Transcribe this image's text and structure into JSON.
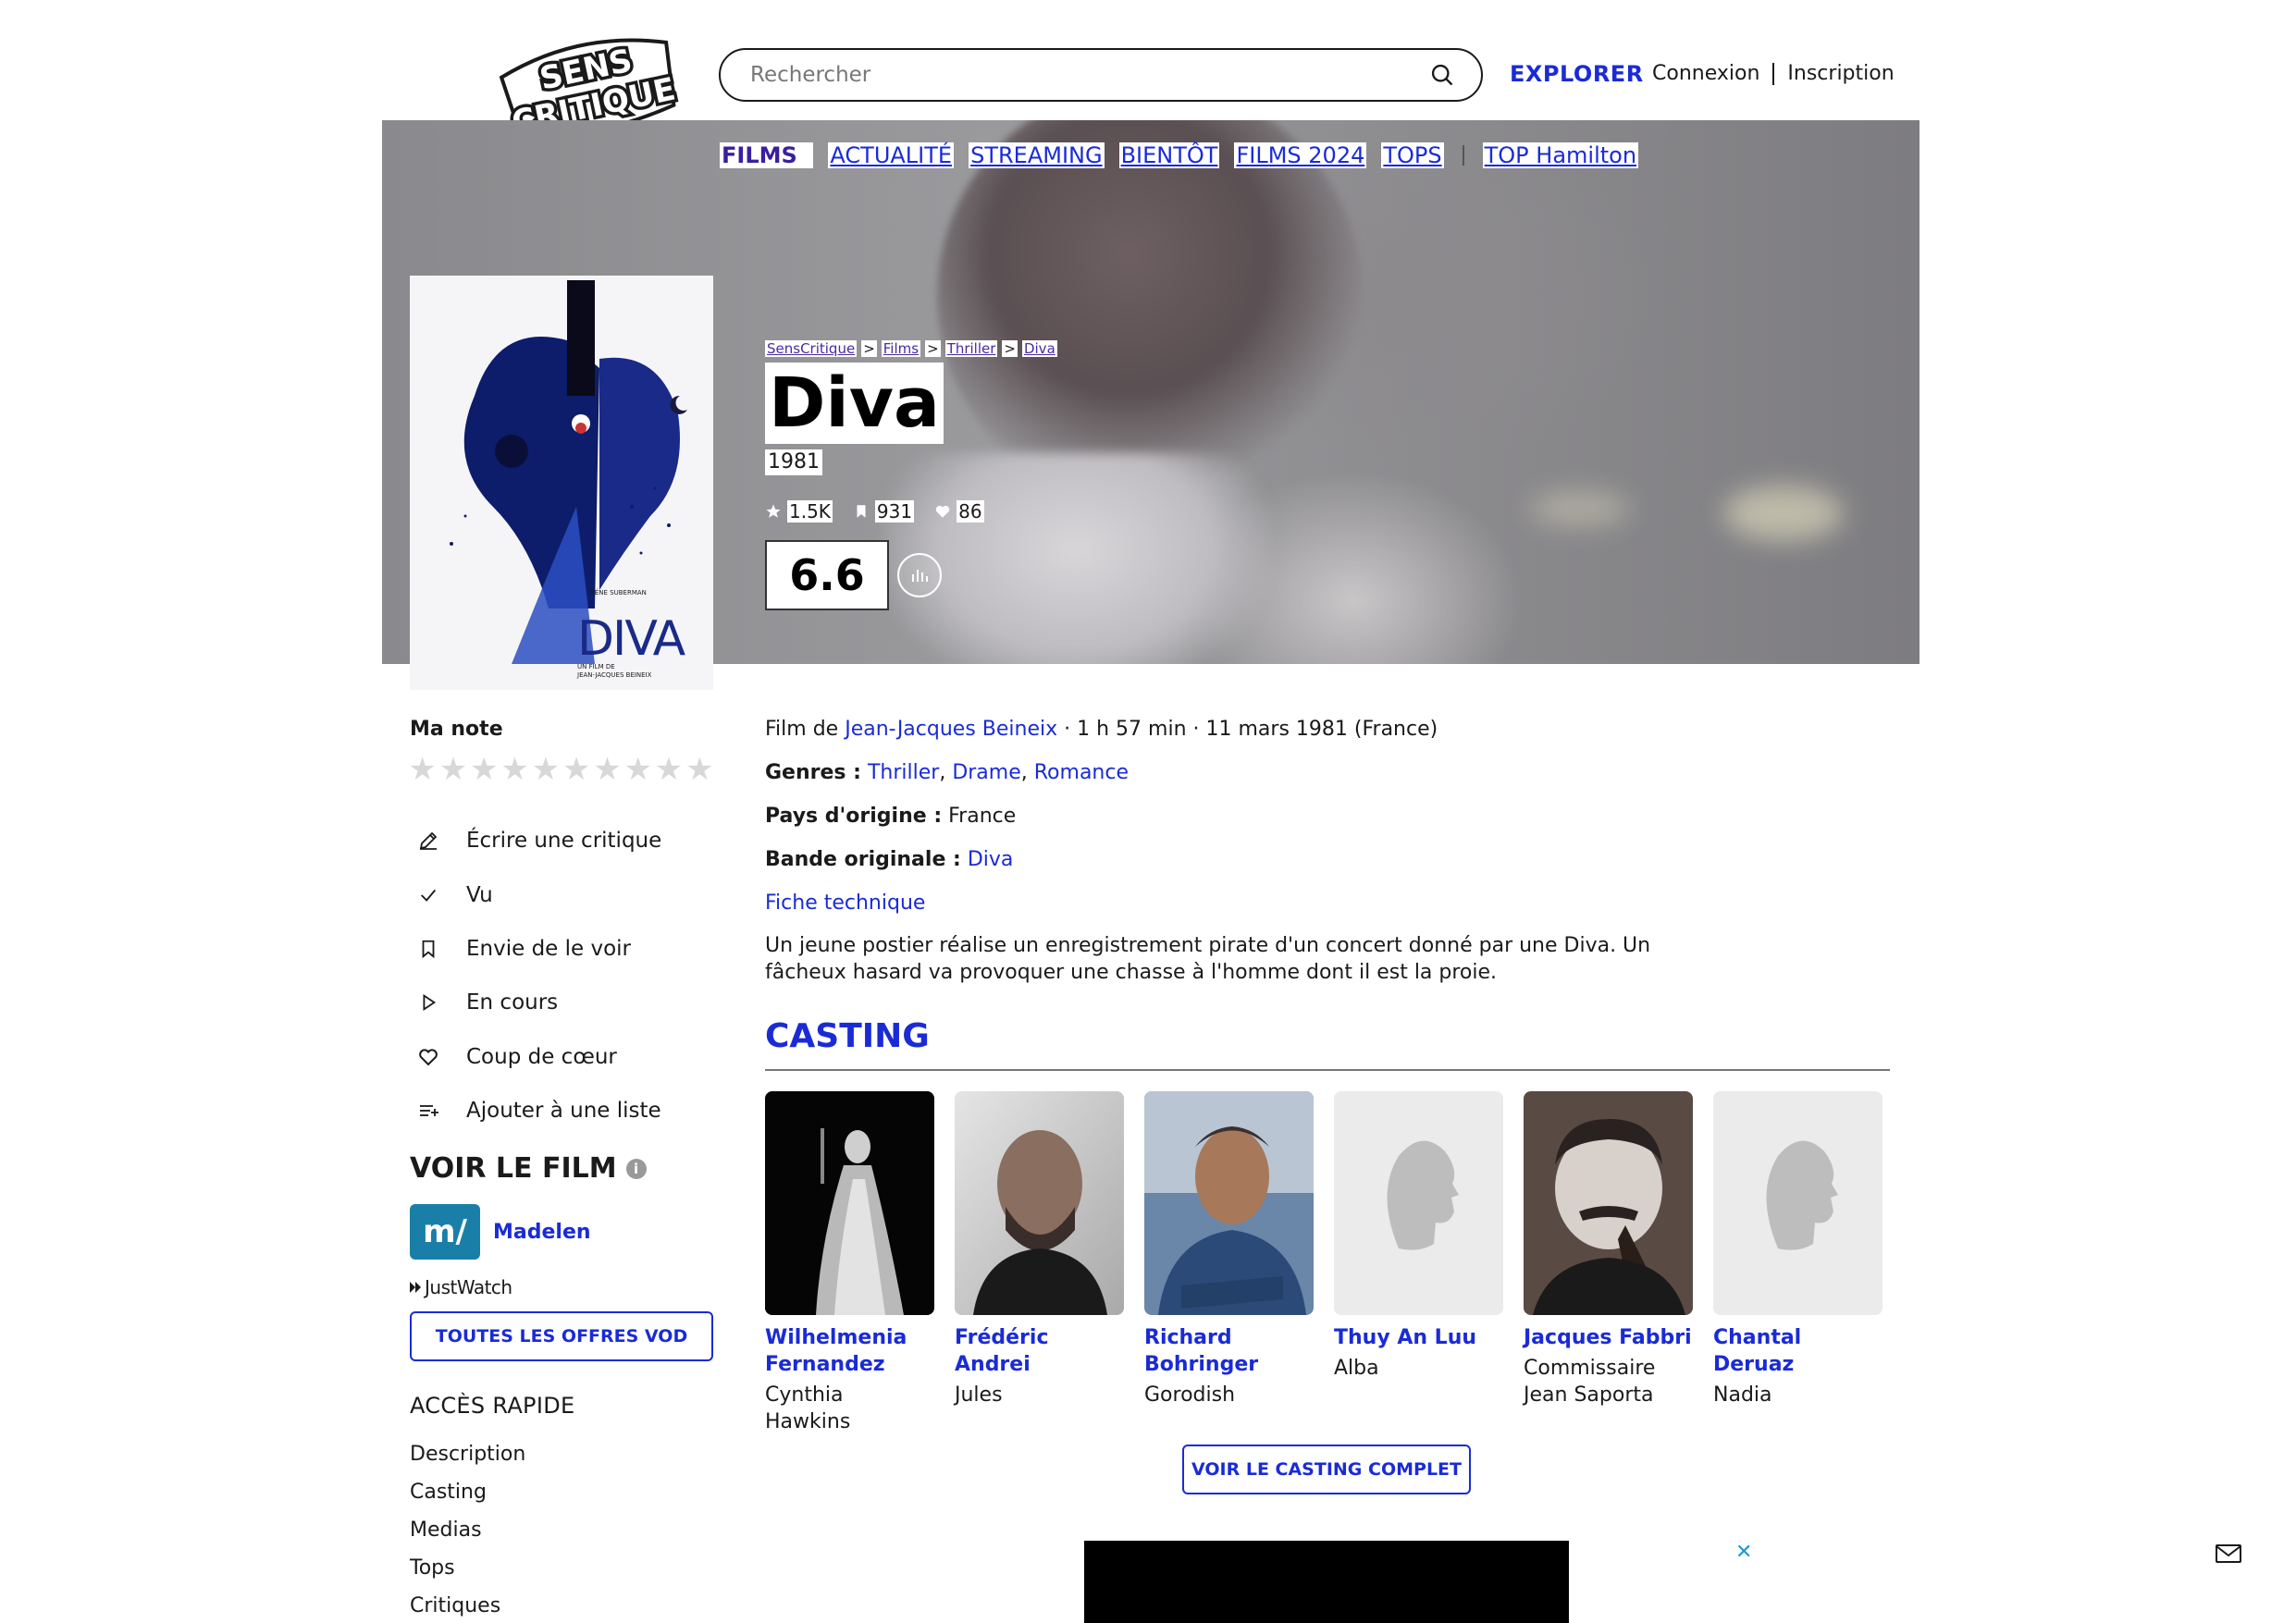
{
  "header": {
    "logo_text": [
      "SENS",
      "CRITIQUE"
    ],
    "search_placeholder": "Rechercher",
    "explorer_label": "EXPLORER",
    "login_label": "Connexion",
    "signup_label": "Inscription"
  },
  "subnav": {
    "films": "FILMS",
    "items": [
      "ACTUALITÉ",
      "STREAMING",
      "BIENTÔT",
      "FILMS 2024",
      "TOPS"
    ],
    "top_label": "TOP Hamilton"
  },
  "breadcrumb": [
    "SensCritique",
    "Films",
    "Thriller",
    "Diva"
  ],
  "breadcrumb_sep": ">",
  "film": {
    "title": "Diva",
    "year": "1981",
    "ratings_count": "1.5K",
    "wishlist_count": "931",
    "favorites_count": "86",
    "score": "6.6",
    "poster": {
      "title": "DIVA",
      "credit_top": "RÉNE SUBERMAN",
      "credit_bottom": [
        "UN FILM DE",
        "JEAN-JACQUES BEINEIX"
      ]
    },
    "info": {
      "film_de_label": "Film de",
      "director": "Jean-Jacques Beineix",
      "duration_date": "· 1 h 57 min · 11 mars 1981 (France)",
      "genres_label": "Genres :",
      "genres": [
        "Thriller",
        "Drame",
        "Romance"
      ],
      "pays_label": "Pays d'origine :",
      "pays": "France",
      "bo_label": "Bande originale :",
      "bo": "Diva",
      "fiche": "Fiche technique"
    },
    "synopsis": "Un jeune postier réalise un enregistrement pirate d'un concert donné par une Diva. Un fâcheux hasard va provoquer une chasse à l'homme dont il est la proie."
  },
  "sidebar": {
    "ma_note": "Ma note",
    "star_count": 10,
    "actions": [
      {
        "label": "Écrire une critique",
        "icon": "pencil-icon"
      },
      {
        "label": "Vu",
        "icon": "check-icon"
      },
      {
        "label": "Envie de le voir",
        "icon": "bookmark-icon"
      },
      {
        "label": "En cours",
        "icon": "play-icon"
      },
      {
        "label": "Coup de cœur",
        "icon": "heart-icon"
      },
      {
        "label": "Ajouter à une liste",
        "icon": "list-add-icon"
      }
    ],
    "voir_title": "VOIR LE FILM",
    "provider_logo": "m/",
    "provider_name": "Madelen",
    "justwatch": "JustWatch",
    "vod_button": "TOUTES LES OFFRES VOD",
    "acces_title": "ACCÈS RAPIDE",
    "acces_items": [
      "Description",
      "Casting",
      "Medias",
      "Tops",
      "Critiques"
    ]
  },
  "casting": {
    "title": "CASTING",
    "actors": [
      {
        "name": "Wilhelmenia Fernandez",
        "role": "Cynthia Hawkins",
        "photo": "stage"
      },
      {
        "name": "Frédéric Andrei",
        "role": "Jules",
        "photo": "portrait"
      },
      {
        "name": "Richard Bohringer",
        "role": "Gorodish",
        "photo": "portrait-blue"
      },
      {
        "name": "Thuy An Luu",
        "role": "Alba",
        "photo": "placeholder"
      },
      {
        "name": "Jacques Fabbri",
        "role": "Commissaire Jean Saporta",
        "photo": "portrait-bw"
      },
      {
        "name": "Chantal Deruaz",
        "role": "Nadia",
        "photo": "placeholder"
      }
    ],
    "full_button": "VOIR LE CASTING COMPLET"
  },
  "ad_close": "✕",
  "colors": {
    "accent": "#1a2bd6",
    "films_tab": "#3a1ea0"
  }
}
